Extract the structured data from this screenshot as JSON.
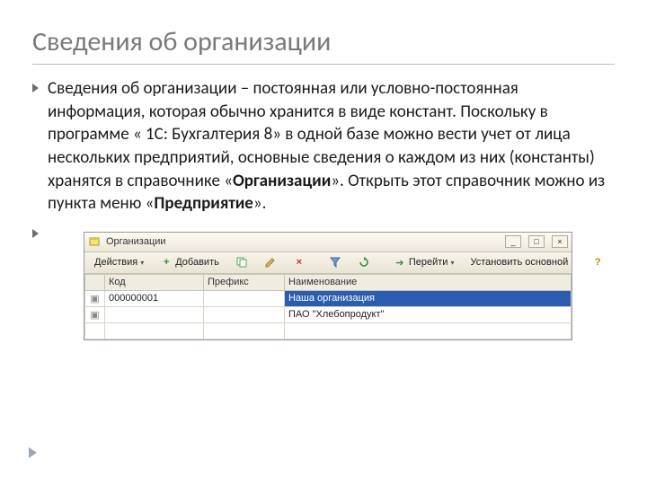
{
  "slide": {
    "title": "Сведения об организации",
    "paragraph_parts": {
      "p1": "Сведения об организации – постоянная или условно-постоянная информация, которая обычно хранится в виде констант. Поскольку в программе « 1С: Бухгалтерия 8» в одной базе можно вести учет от лица нескольких предприятий, основные сведения о каждом из них (константы) хранятся в справочнике «",
      "b1": "Организации",
      "p2": "». Открыть этот справочник можно из пункта меню «",
      "b2": "Предприятие",
      "p3": "». "
    }
  },
  "window": {
    "title": "Организации",
    "toolbar": {
      "actions": "Действия",
      "add": "Добавить",
      "goto": "Перейти",
      "set_main": "Установить основной"
    },
    "columns": {
      "mark": "",
      "code": "Код",
      "prefix": "Префикс",
      "name": "Наименование"
    },
    "rows": [
      {
        "code": "000000001",
        "prefix": "",
        "name": "Наша организация"
      },
      {
        "code": "",
        "prefix": "",
        "name": "ПАО \"Хлебопродукт\""
      }
    ]
  }
}
